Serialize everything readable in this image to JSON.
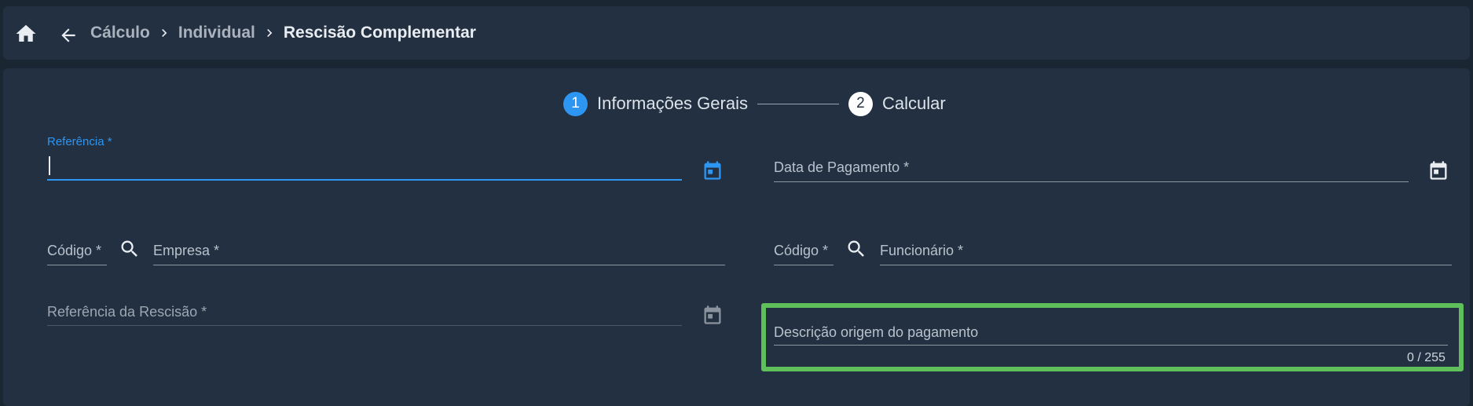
{
  "breadcrumb": {
    "items": [
      "Cálculo",
      "Individual",
      "Rescisão Complementar"
    ]
  },
  "stepper": {
    "steps": [
      {
        "number": "1",
        "label": "Informações Gerais",
        "active": true
      },
      {
        "number": "2",
        "label": "Calcular",
        "active": false
      }
    ]
  },
  "form": {
    "referencia": {
      "label": "Referência *",
      "value": ""
    },
    "data_pagamento": {
      "label": "Data de Pagamento *",
      "value": ""
    },
    "empresa_codigo": {
      "label": "Código *",
      "value": ""
    },
    "empresa": {
      "label": "Empresa *",
      "value": ""
    },
    "funcionario_codigo": {
      "label": "Código *",
      "value": ""
    },
    "funcionario": {
      "label": "Funcionário *",
      "value": ""
    },
    "referencia_rescisao": {
      "label": "Referência da Rescisão *",
      "value": ""
    },
    "descricao_origem": {
      "label": "Descrição origem do pagamento",
      "value": "",
      "counter": "0 / 255"
    }
  },
  "colors": {
    "accent": "#2d96f3",
    "panel": "#223041",
    "background": "#1b2633",
    "highlight": "#5fbf5a"
  },
  "icons": [
    "home-icon",
    "arrow-left-icon",
    "chevron-right-icon",
    "calendar-icon",
    "search-icon"
  ]
}
